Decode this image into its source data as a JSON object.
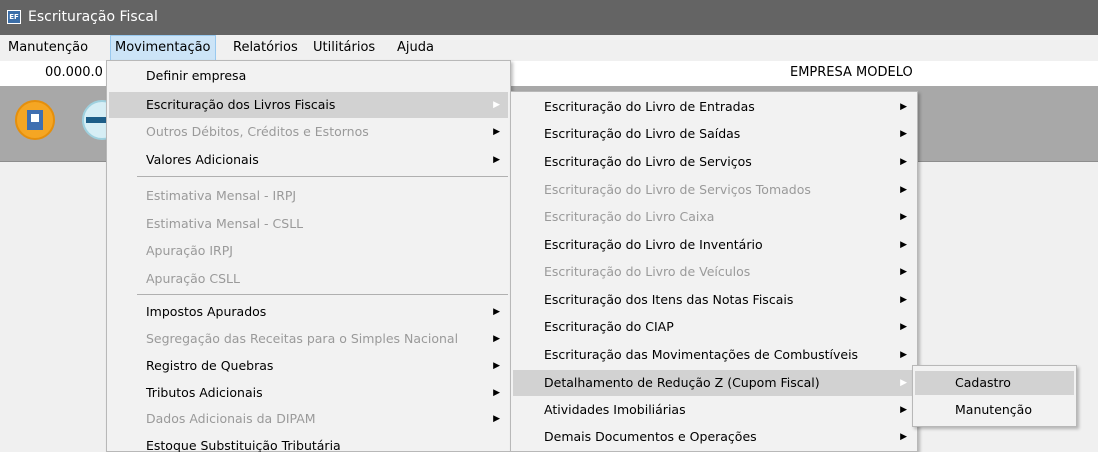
{
  "window": {
    "title": "Escrituração Fiscal",
    "icon": "app-icon"
  },
  "menubar": {
    "items": [
      {
        "label": "Manutenção"
      },
      {
        "label": "Movimentação"
      },
      {
        "label": "Relatórios"
      },
      {
        "label": "Utilitários"
      },
      {
        "label": "Ajuda"
      }
    ]
  },
  "info": {
    "code": "00.000.0",
    "company": "EMPRESA MODELO"
  },
  "toolbar": {
    "icons": [
      "building-icon",
      "sped-icon"
    ]
  },
  "movimentacao_menu": {
    "items": [
      {
        "label": "Definir empresa",
        "enabled": true
      },
      {
        "label": "Escrituração dos Livros Fiscais",
        "enabled": true,
        "submenu": true,
        "highlighted": true
      },
      {
        "label": "Outros Débitos, Créditos e Estornos",
        "enabled": false,
        "submenu": true
      },
      {
        "label": "Valores Adicionais",
        "enabled": true,
        "submenu": true
      },
      {
        "label": "Estimativa Mensal - IRPJ",
        "enabled": false
      },
      {
        "label": "Estimativa Mensal - CSLL",
        "enabled": false
      },
      {
        "label": "Apuração IRPJ",
        "enabled": false
      },
      {
        "label": "Apuração CSLL",
        "enabled": false
      },
      {
        "label": "Impostos Apurados",
        "enabled": true,
        "submenu": true
      },
      {
        "label": "Segregação das Receitas para o Simples Nacional",
        "enabled": false,
        "submenu": true
      },
      {
        "label": "Registro de Quebras",
        "enabled": true,
        "submenu": true
      },
      {
        "label": "Tributos Adicionais",
        "enabled": true,
        "submenu": true
      },
      {
        "label": "Dados Adicionais da DIPAM",
        "enabled": false,
        "submenu": true
      },
      {
        "label": "Estoque Substituição Tributária",
        "enabled": true
      }
    ]
  },
  "escrituracao_menu": {
    "items": [
      {
        "label": "Escrituração do Livro de Entradas",
        "enabled": true
      },
      {
        "label": "Escrituração do Livro de Saídas",
        "enabled": true
      },
      {
        "label": "Escrituração do Livro de Serviços",
        "enabled": true
      },
      {
        "label": "Escrituração do Livro de Serviços Tomados",
        "enabled": false
      },
      {
        "label": "Escrituração do Livro Caixa",
        "enabled": false
      },
      {
        "label": "Escrituração do Livro de Inventário",
        "enabled": true
      },
      {
        "label": "Escrituração do Livro de Veículos",
        "enabled": false
      },
      {
        "label": "Escrituração dos Itens das Notas Fiscais",
        "enabled": true
      },
      {
        "label": "Escrituração do CIAP",
        "enabled": true
      },
      {
        "label": "Escrituração das Movimentações de Combustíveis",
        "enabled": true
      },
      {
        "label": "Detalhamento de Redução Z (Cupom Fiscal)",
        "enabled": true,
        "highlighted": true
      },
      {
        "label": "Atividades Imobiliárias",
        "enabled": true
      },
      {
        "label": "Demais Documentos e Operações",
        "enabled": true
      }
    ]
  },
  "reducao_menu": {
    "items": [
      {
        "label": "Cadastro",
        "highlighted": true
      },
      {
        "label": "Manutenção"
      }
    ]
  },
  "glyphs": {
    "submenu_arrow": "▶"
  }
}
